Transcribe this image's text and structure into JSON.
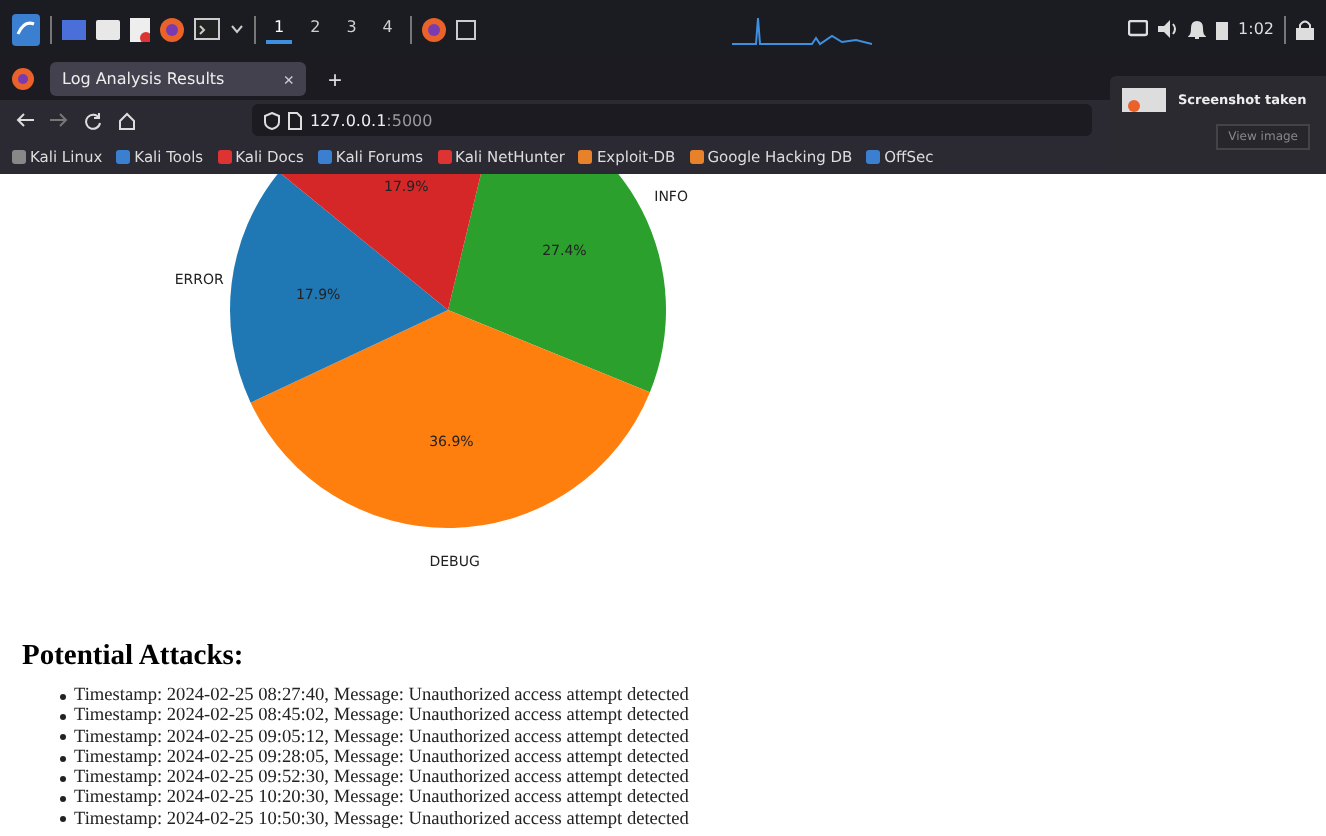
{
  "taskbar": {
    "workspaces": [
      {
        "label": "1",
        "selected": true
      },
      {
        "label": "2",
        "selected": false
      },
      {
        "label": "3",
        "selected": false
      },
      {
        "label": "4",
        "selected": false
      }
    ],
    "clock": "1:02"
  },
  "browser": {
    "tab": {
      "title": "Log Analysis Results",
      "close": "×"
    },
    "new_tab": "+",
    "url": {
      "host": "127.0.0.1",
      "port": ":5000"
    },
    "bookmarks": [
      "Kali Linux",
      "Kali Tools",
      "Kali Docs",
      "Kali Forums",
      "Kali NetHunter",
      "Exploit-DB",
      "Google Hacking DB",
      "OffSec"
    ]
  },
  "notification": {
    "title": "Screenshot taken",
    "button": "View image"
  },
  "page": {
    "chart_data": {
      "type": "pie",
      "categories": [
        "INFO",
        "DEBUG",
        "ERROR",
        null
      ],
      "values": [
        27.4,
        36.9,
        17.9,
        17.9
      ],
      "data_labels": true,
      "value_labels": [
        "27.4%",
        "36.9%",
        "17.9%",
        "17.9%"
      ]
    },
    "heading": "Potential Attacks:",
    "attacks": [
      "Timestamp: 2024-02-25 08:27:40, Message: Unauthorized access attempt detected",
      "Timestamp: 2024-02-25 08:45:02, Message: Unauthorized access attempt detected",
      "Timestamp: 2024-02-25 09:05:12, Message: Unauthorized access attempt detected",
      "Timestamp: 2024-02-25 09:28:05, Message: Unauthorized access attempt detected",
      "Timestamp: 2024-02-25 09:52:30, Message: Unauthorized access attempt detected",
      "Timestamp: 2024-02-25 10:20:30, Message: Unauthorized access attempt detected",
      "Timestamp: 2024-02-25 10:50:30, Message: Unauthorized access attempt detected"
    ]
  }
}
